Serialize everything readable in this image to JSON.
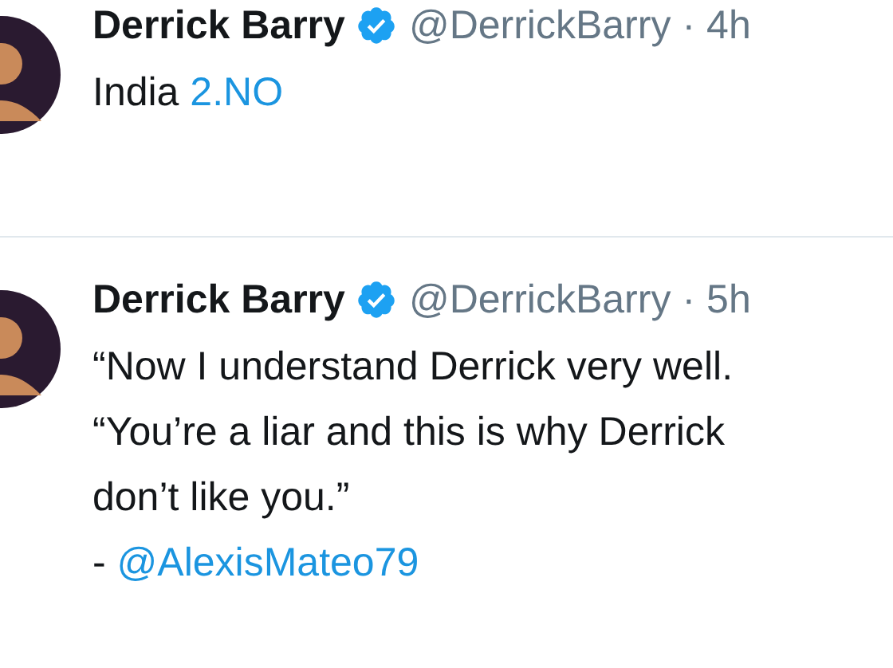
{
  "tweets": [
    {
      "name": "Derrick Barry",
      "verified": true,
      "handle": "@DerrickBarry",
      "separator": "·",
      "time": "4h",
      "lines": [
        [
          {
            "kind": "text",
            "text": "India "
          },
          {
            "kind": "link",
            "text": "2.NO"
          }
        ]
      ]
    },
    {
      "name": "Derrick Barry",
      "verified": true,
      "handle": "@DerrickBarry",
      "separator": "·",
      "time": "5h",
      "lines": [
        [
          {
            "kind": "text",
            "text": "“Now I understand Derrick very well."
          }
        ],
        [
          {
            "kind": "text",
            "text": "“You’re a liar and this is why Derrick"
          }
        ],
        [
          {
            "kind": "text",
            "text": "don’t like you.”"
          }
        ],
        [
          {
            "kind": "text",
            "text": "- "
          },
          {
            "kind": "link",
            "text": "@AlexisMateo79"
          }
        ]
      ]
    }
  ]
}
